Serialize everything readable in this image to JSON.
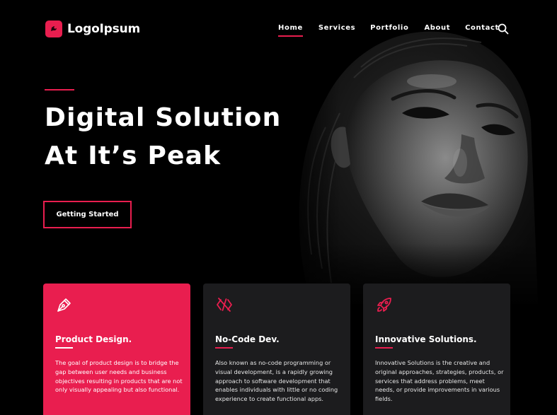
{
  "brand": {
    "name": "LogoIpsum",
    "accent": "#e91e4f"
  },
  "nav": {
    "items": [
      "Home",
      "Services",
      "Portfolio",
      "About",
      "Contact"
    ],
    "active": "Home"
  },
  "hero": {
    "title_line1": "Digital Solution",
    "title_line2": "At It’s Peak",
    "cta_label": "Getting Started"
  },
  "cards": [
    {
      "icon": "pen-nib-icon",
      "title": "Product Design.",
      "body": "The goal of product design is to bridge the gap between user needs and business objectives resulting in products that are not only visually appealing but also functional.",
      "highlight": true
    },
    {
      "icon": "code-slash-icon",
      "title": "No-Code Dev.",
      "body": "Also known as no-code programming or visual development, is a rapidly growing approach to software development that enables individuals with little or no coding experience to create functional apps.",
      "highlight": false
    },
    {
      "icon": "rocket-icon",
      "title": "Innovative Solutions.",
      "body": "Innovative Solutions is the creative and original approaches, strategies, products, or services that address problems, meet needs, or provide improvements in various fields.",
      "highlight": false
    }
  ]
}
